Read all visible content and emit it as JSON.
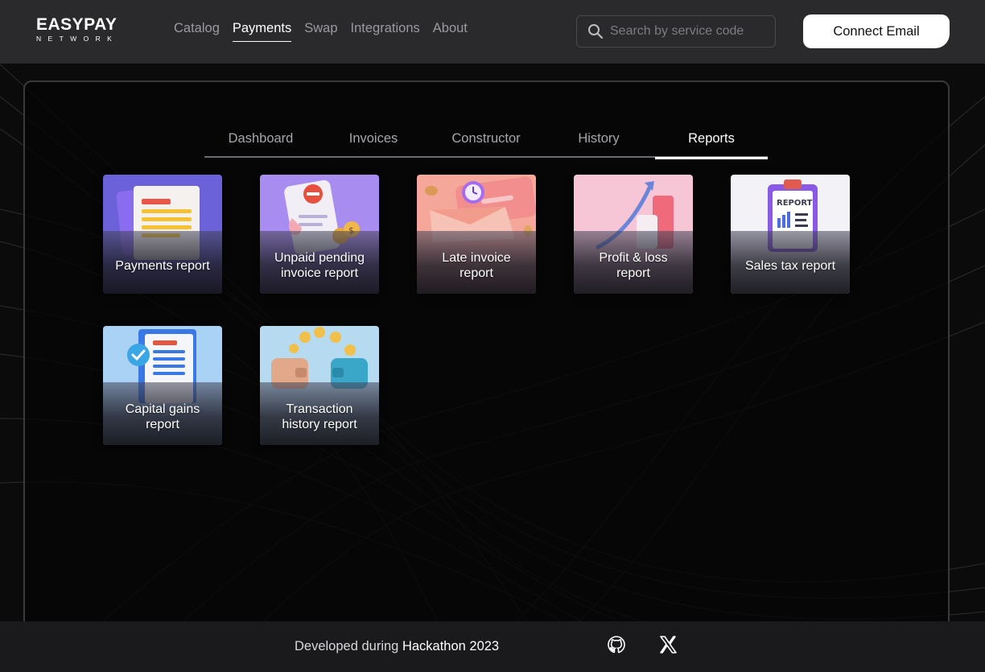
{
  "header": {
    "logo_main": "EASYPAY",
    "logo_sub": "NETWORK",
    "nav": [
      {
        "label": "Catalog",
        "active": false
      },
      {
        "label": "Payments",
        "active": true
      },
      {
        "label": "Swap",
        "active": false
      },
      {
        "label": "Integrations",
        "active": false
      },
      {
        "label": "About",
        "active": false
      }
    ],
    "search_placeholder": "Search by service code",
    "connect_label": "Connect Email"
  },
  "tabs": [
    {
      "label": "Dashboard",
      "active": false
    },
    {
      "label": "Invoices",
      "active": false
    },
    {
      "label": "Constructor",
      "active": false
    },
    {
      "label": "History",
      "active": false
    },
    {
      "label": "Reports",
      "active": true
    }
  ],
  "reports": [
    {
      "line1": "Payments report",
      "line2": "",
      "icon": "document-icon"
    },
    {
      "line1": "Unpaid pending",
      "line2": "invoice report",
      "icon": "unpaid-invoice-icon"
    },
    {
      "line1": "Late invoice",
      "line2": "report",
      "icon": "late-invoice-clock-icon"
    },
    {
      "line1": "Profit & loss",
      "line2": "report",
      "icon": "growth-chart-icon"
    },
    {
      "line1": "Sales tax report",
      "line2": "",
      "icon": "clipboard-report-icon"
    },
    {
      "line1": "Capital gains",
      "line2": "report",
      "icon": "approved-document-icon"
    },
    {
      "line1": "Transaction",
      "line2": "history report",
      "icon": "wallet-coins-icon"
    }
  ],
  "footer": {
    "prefix": "Developed during",
    "event": "Hackathon 2023"
  },
  "colors": {
    "header_bg": "#2a2a2c",
    "page_bg": "#0b0b0c",
    "accent": "#ffffff",
    "muted_text": "#9a9aa0"
  }
}
